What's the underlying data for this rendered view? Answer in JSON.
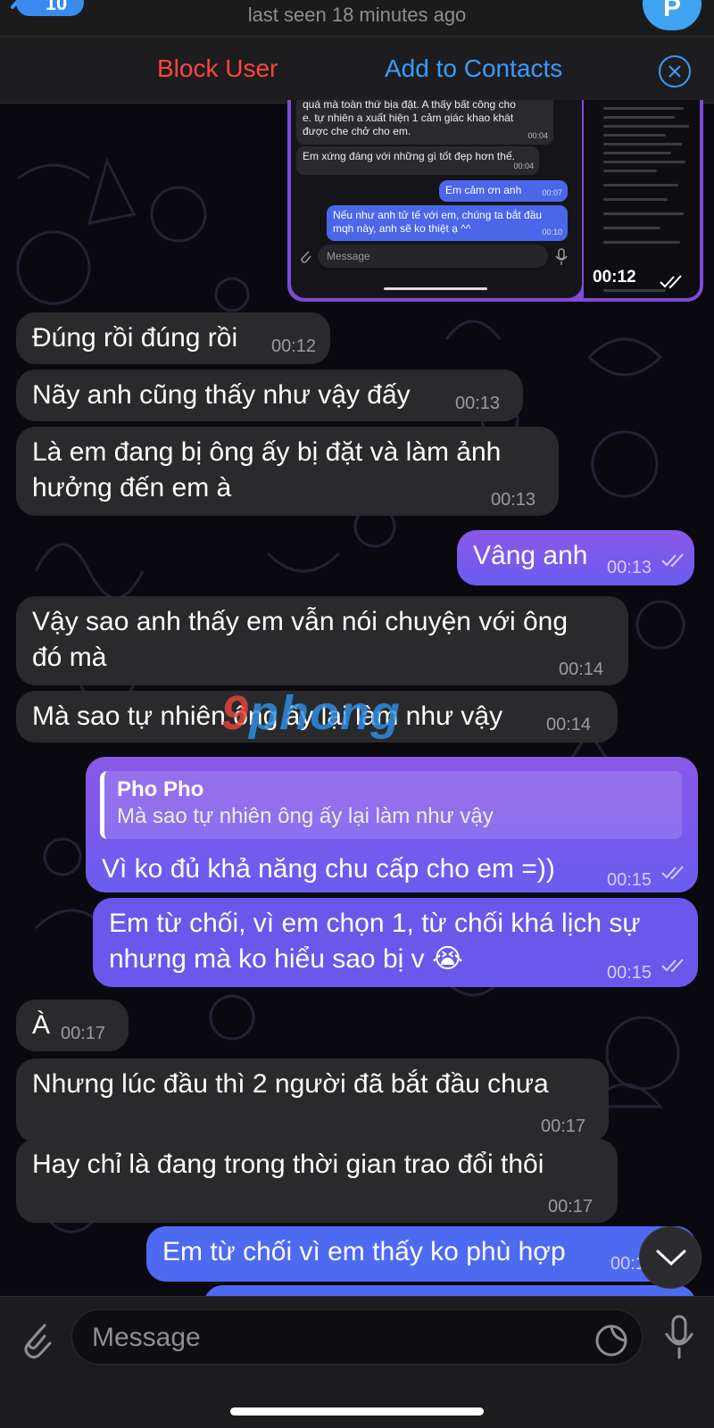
{
  "header": {
    "back_count": "10",
    "status": "last seen 18 minutes ago",
    "avatar_letter": "P"
  },
  "actions": {
    "block": "Block User",
    "add_contacts": "Add to Contacts"
  },
  "image_message": {
    "inner_lines": [
      "quá mà toàn thứ bịa đặt. A thấy bất công cho",
      "e. tự nhiên a xuất hiện 1 cảm giác khao khát",
      "được che chở cho em."
    ],
    "inner_time_1": "00:04",
    "inner_msg_2": "Em xứng đáng với những gì tốt đẹp hơn thế.",
    "inner_time_2": "00:04",
    "inner_msg_3": "Em cảm ơn anh",
    "inner_time_3": "00:07",
    "inner_msg_4_line1": "Nếu như anh tử tế với em, chúng ta bắt đầu",
    "inner_msg_4_line2": "mqh này, anh sẽ ko thiệt ạ ^^",
    "inner_time_4": "00:10",
    "inner_placeholder": "Message",
    "time": "00:12"
  },
  "messages": [
    {
      "text": "Đúng rồi đúng rồi",
      "time": "00:12"
    },
    {
      "text": "Nãy anh cũng thấy như vậy đấy",
      "time": "00:13"
    },
    {
      "line1": "Là em đang bị ông ấy bị đặt và làm ảnh",
      "line2": "hưởng đến em à",
      "time": "00:13"
    },
    {
      "text": "Vâng anh",
      "time": "00:13"
    },
    {
      "line1": "Vậy sao anh thấy em vẫn nói chuyện với ông",
      "line2": "đó mà",
      "time": "00:14"
    },
    {
      "text": "Mà sao tự nhiên ông ấy lại làm như vậy",
      "time": "00:14"
    },
    {
      "reply_name": "Pho Pho",
      "reply_text": "Mà sao tự nhiên ông ấy lại làm như vậy",
      "text": "Vì ko đủ khả năng chu cấp cho em =))",
      "time": "00:15"
    },
    {
      "line1": "Em từ chối, vì em chọn 1, từ chối khá lịch sự",
      "line2": "nhưng mà ko hiểu sao bị v 😭",
      "time": "00:15"
    },
    {
      "text": "À",
      "time": "00:17"
    },
    {
      "text": "Nhưng lúc đầu thì 2 người đã bắt đầu chưa",
      "time": "00:17"
    },
    {
      "text": "Hay chỉ là đang trong thời gian trao đổi thôi",
      "time": "00:17"
    },
    {
      "text": "Em từ chối vì em thấy ko phù hợp",
      "time": "00:1"
    }
  ],
  "watermark": {
    "part1": "9",
    "part2": "phong"
  },
  "composer": {
    "placeholder": "Message"
  },
  "colors": {
    "outgoing": "#7b53e0",
    "incoming": "#2a2a2d",
    "accent": "#3a9bff",
    "danger": "#ff453a"
  }
}
